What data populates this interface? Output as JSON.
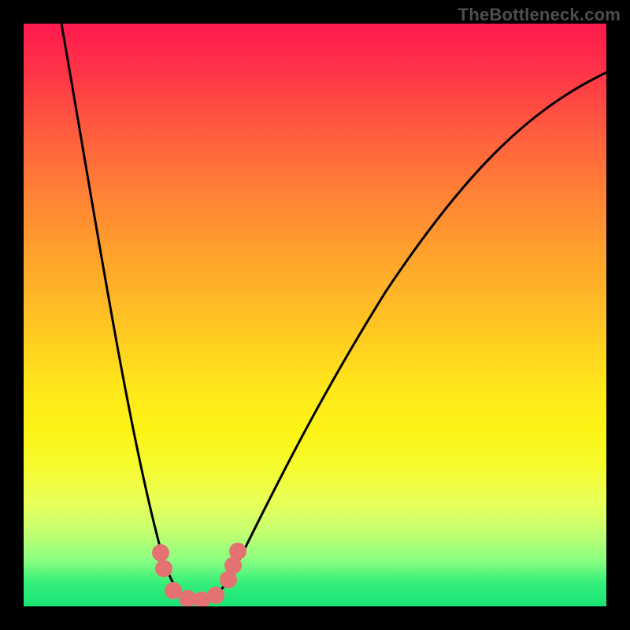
{
  "watermark": "TheBottleneck.com",
  "chart_data": {
    "type": "line",
    "title": "",
    "xlabel": "",
    "ylabel": "",
    "xlim": [
      0,
      100
    ],
    "ylim": [
      0,
      100
    ],
    "background_gradient": {
      "stops": [
        {
          "pos": 0,
          "color": "#ff1a4f"
        },
        {
          "pos": 18,
          "color": "#ff5a3f"
        },
        {
          "pos": 40,
          "color": "#ffa32c"
        },
        {
          "pos": 62,
          "color": "#ffe61a"
        },
        {
          "pos": 82,
          "color": "#e9ff58"
        },
        {
          "pos": 100,
          "color": "#19e474"
        }
      ]
    },
    "series": [
      {
        "name": "bottleneck-curve",
        "x": [
          6,
          12,
          17,
          22,
          25,
          28,
          31,
          34,
          38,
          45,
          55,
          70,
          85,
          100
        ],
        "y": [
          100,
          75,
          52,
          30,
          15,
          5,
          1,
          3,
          10,
          25,
          45,
          65,
          82,
          92
        ]
      },
      {
        "name": "markers",
        "x": [
          23.5,
          24,
          25.5,
          28,
          30.5,
          33,
          35,
          36,
          36.8
        ],
        "y": [
          9.2,
          6.5,
          2.7,
          1.4,
          1.1,
          1.9,
          4.6,
          7.0,
          9.5
        ]
      }
    ],
    "annotations": [
      {
        "text": "TheBottleneck.com",
        "position": "top-right"
      }
    ]
  }
}
